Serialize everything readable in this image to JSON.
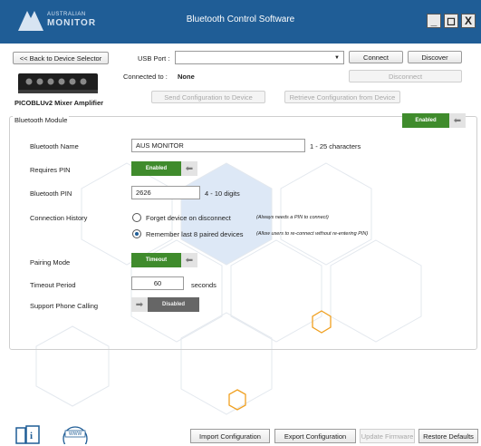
{
  "window": {
    "title": "Bluetooth Control Software",
    "logo_line1": "AUSTRALIAN",
    "logo_line2": "MONITOR",
    "minimize": "_",
    "maximize": "◻",
    "close": "X"
  },
  "toolbar": {
    "back_label": "<< Back to Device Selector",
    "usb_label": "USB Port :",
    "usb_value": "",
    "connect_label": "Connect",
    "discover_label": "Discover",
    "connected_to_label": "Connected to :",
    "connected_to_value": "None",
    "disconnect_label": "Disconnect",
    "send_config_label": "Send Configuration to Device",
    "retrieve_config_label": "Retrieve Configuration from Device",
    "device_name": "PICOBLUv2 Mixer Amplifier"
  },
  "bluetooth_module": {
    "title": "Bluetooth Module",
    "status": "Enabled",
    "name_label": "Bluetooth Name",
    "name_value": "AUS MONITOR",
    "name_hint": "1 - 25 characters",
    "requires_pin_label": "Requires PIN",
    "requires_pin_status": "Enabled",
    "pin_label": "Bluetooth PIN",
    "pin_value": "2626",
    "pin_hint": "4 - 10 digits",
    "history_label": "Connection History",
    "history_options": [
      {
        "label": "Forget device on disconnect",
        "note": "(Always needs a PIN to connect)",
        "selected": false
      },
      {
        "label": "Remember last 8 paired devices",
        "note": "(Allow users to re-connect without re-entering PIN)",
        "selected": true
      }
    ],
    "pairing_label": "Pairing Mode",
    "pairing_value": "Timeout",
    "timeout_label": "Timeout Period",
    "timeout_value": "60",
    "timeout_unit": "seconds",
    "phone_label": "Support Phone Calling",
    "phone_status": "Disabled"
  },
  "footer": {
    "import_label": "Import Configuration",
    "export_label": "Export Configuration",
    "update_label": "Update Firmware",
    "restore_label": "Restore Defaults",
    "www_label": "WWW"
  },
  "colors": {
    "titlebar": "#1f5d96",
    "enabled": "#3f8b2c",
    "disabled": "#666666",
    "accent_hex": "#f0a020"
  }
}
